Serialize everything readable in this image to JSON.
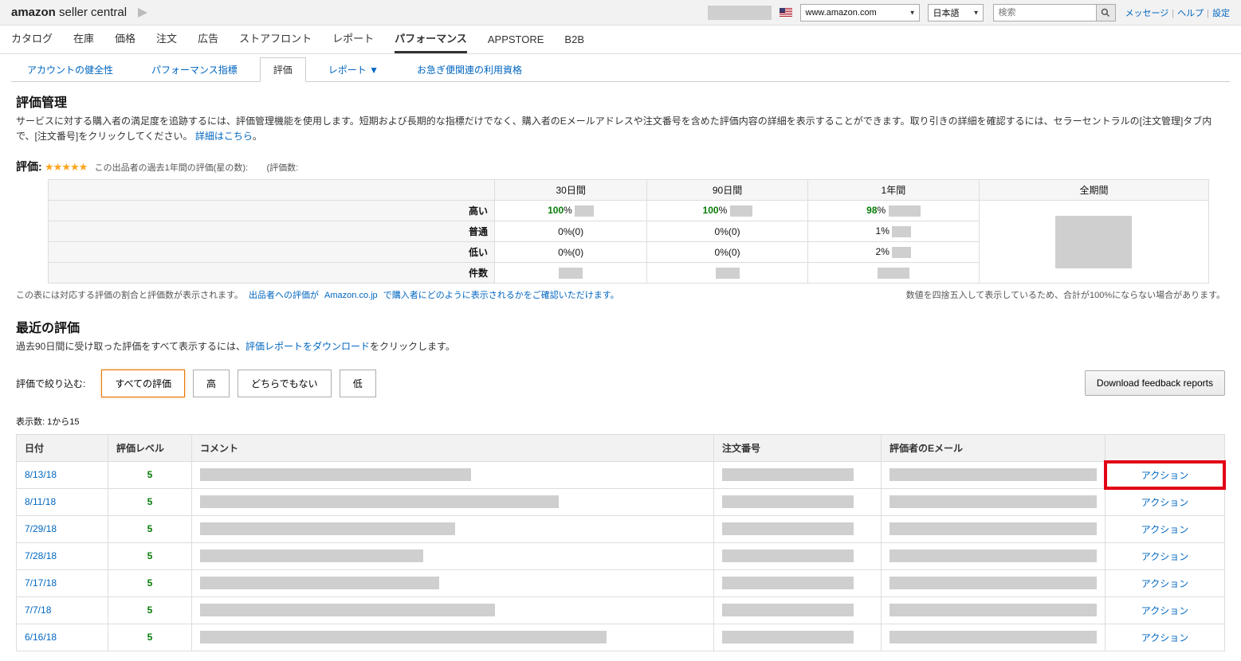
{
  "topbar": {
    "logo_bold": "amazon",
    "logo_light": " seller central",
    "marketplace": "www.amazon.com",
    "language": "日本語",
    "search_placeholder": "検索",
    "links": [
      "メッセージ",
      "ヘルプ",
      "設定"
    ]
  },
  "mainnav": {
    "items": [
      "カタログ",
      "在庫",
      "価格",
      "注文",
      "広告",
      "ストアフロント",
      "レポート",
      "パフォーマンス",
      "APPSTORE",
      "B2B"
    ],
    "active_index": 7
  },
  "subnav": {
    "items": [
      "アカウントの健全性",
      "パフォーマンス指標",
      "評価",
      "レポート ▼",
      "お急ぎ便関連の利用資格"
    ],
    "active_index": 2
  },
  "page": {
    "title": "評価管理",
    "desc_pre": "サービスに対する購入者の満足度を追跡するには、評価管理機能を使用します。短期および長期的な指標だけでなく、購入者のEメールアドレスや注文番号を含めた評価内容の詳細を表示することができます。取り引きの詳細を確認するには、セラーセントラルの[注文管理]タブ内で、[注文番号]をクリックしてください。",
    "desc_link": "詳細はこちら",
    "rating_label": "評価:",
    "rating_meta1": "この出品者の過去1年間の評価(星の数):",
    "rating_meta2": "(評価数:"
  },
  "stats": {
    "cols": [
      "30日間",
      "90日間",
      "1年間",
      "全期間"
    ],
    "rows": [
      {
        "label": "高い",
        "cells": [
          {
            "v": "100",
            "suffix": "%",
            "good": true,
            "redactW": 24
          },
          {
            "v": "100",
            "suffix": "%",
            "good": true,
            "redactW": 28
          },
          {
            "v": "98",
            "suffix": "%",
            "good": true,
            "redactW": 40
          },
          {
            "big": true
          }
        ]
      },
      {
        "label": "普通",
        "cells": [
          {
            "v": "0",
            "suffix": "%(0)"
          },
          {
            "v": "0",
            "suffix": "%(0)"
          },
          {
            "v": "1",
            "suffix": "%",
            "redactW": 24
          },
          {
            "big": true
          }
        ]
      },
      {
        "label": "低い",
        "cells": [
          {
            "v": "0",
            "suffix": "%(0)"
          },
          {
            "v": "0",
            "suffix": "%(0)"
          },
          {
            "v": "2",
            "suffix": "%",
            "redactW": 24
          },
          {
            "big": true
          }
        ]
      },
      {
        "label": "件数",
        "cells": [
          {
            "redactW": 30
          },
          {
            "redactW": 30
          },
          {
            "redactW": 40
          },
          {
            "big": true
          }
        ]
      }
    ],
    "note_left_pre": "この表には対応する評価の割合と評価数が表示されます。",
    "note_left_link1": "出品者への評価が",
    "note_left_link2": "Amazon.co.jp",
    "note_left_post": "で購入者にどのように表示されるかをご確認いただけます。",
    "note_right": "数値を四捨五入して表示しているため、合計が100%にならない場合があります。"
  },
  "recent": {
    "title": "最近の評価",
    "desc_pre": "過去90日間に受け取った評価をすべて表示するには、",
    "desc_link": "評価レポートをダウンロード",
    "desc_post": "をクリックします。"
  },
  "filter": {
    "label": "評価で絞り込む:",
    "buttons": [
      "すべての評価",
      "高",
      "どちらでもない",
      "低"
    ],
    "active_index": 0,
    "download": "Download feedback reports"
  },
  "list": {
    "count_label": "表示数:  1から15",
    "headers": [
      "日付",
      "評価レベル",
      "コメント",
      "注文番号",
      "評価者のEメール",
      ""
    ],
    "action_label": "アクション",
    "rows": [
      {
        "date": "8/13/18",
        "level": "5",
        "commentW": 340,
        "orderW": 165,
        "emailW": 260,
        "highlight": true
      },
      {
        "date": "8/11/18",
        "level": "5",
        "commentW": 450,
        "orderW": 165,
        "emailW": 260
      },
      {
        "date": "7/29/18",
        "level": "5",
        "commentW": 320,
        "orderW": 165,
        "emailW": 260
      },
      {
        "date": "7/28/18",
        "level": "5",
        "commentW": 280,
        "orderW": 165,
        "emailW": 260
      },
      {
        "date": "7/17/18",
        "level": "5",
        "commentW": 300,
        "orderW": 165,
        "emailW": 260
      },
      {
        "date": "7/7/18",
        "level": "5",
        "commentW": 370,
        "orderW": 165,
        "emailW": 260
      },
      {
        "date": "6/16/18",
        "level": "5",
        "commentW": 510,
        "orderW": 165,
        "emailW": 260
      }
    ]
  }
}
